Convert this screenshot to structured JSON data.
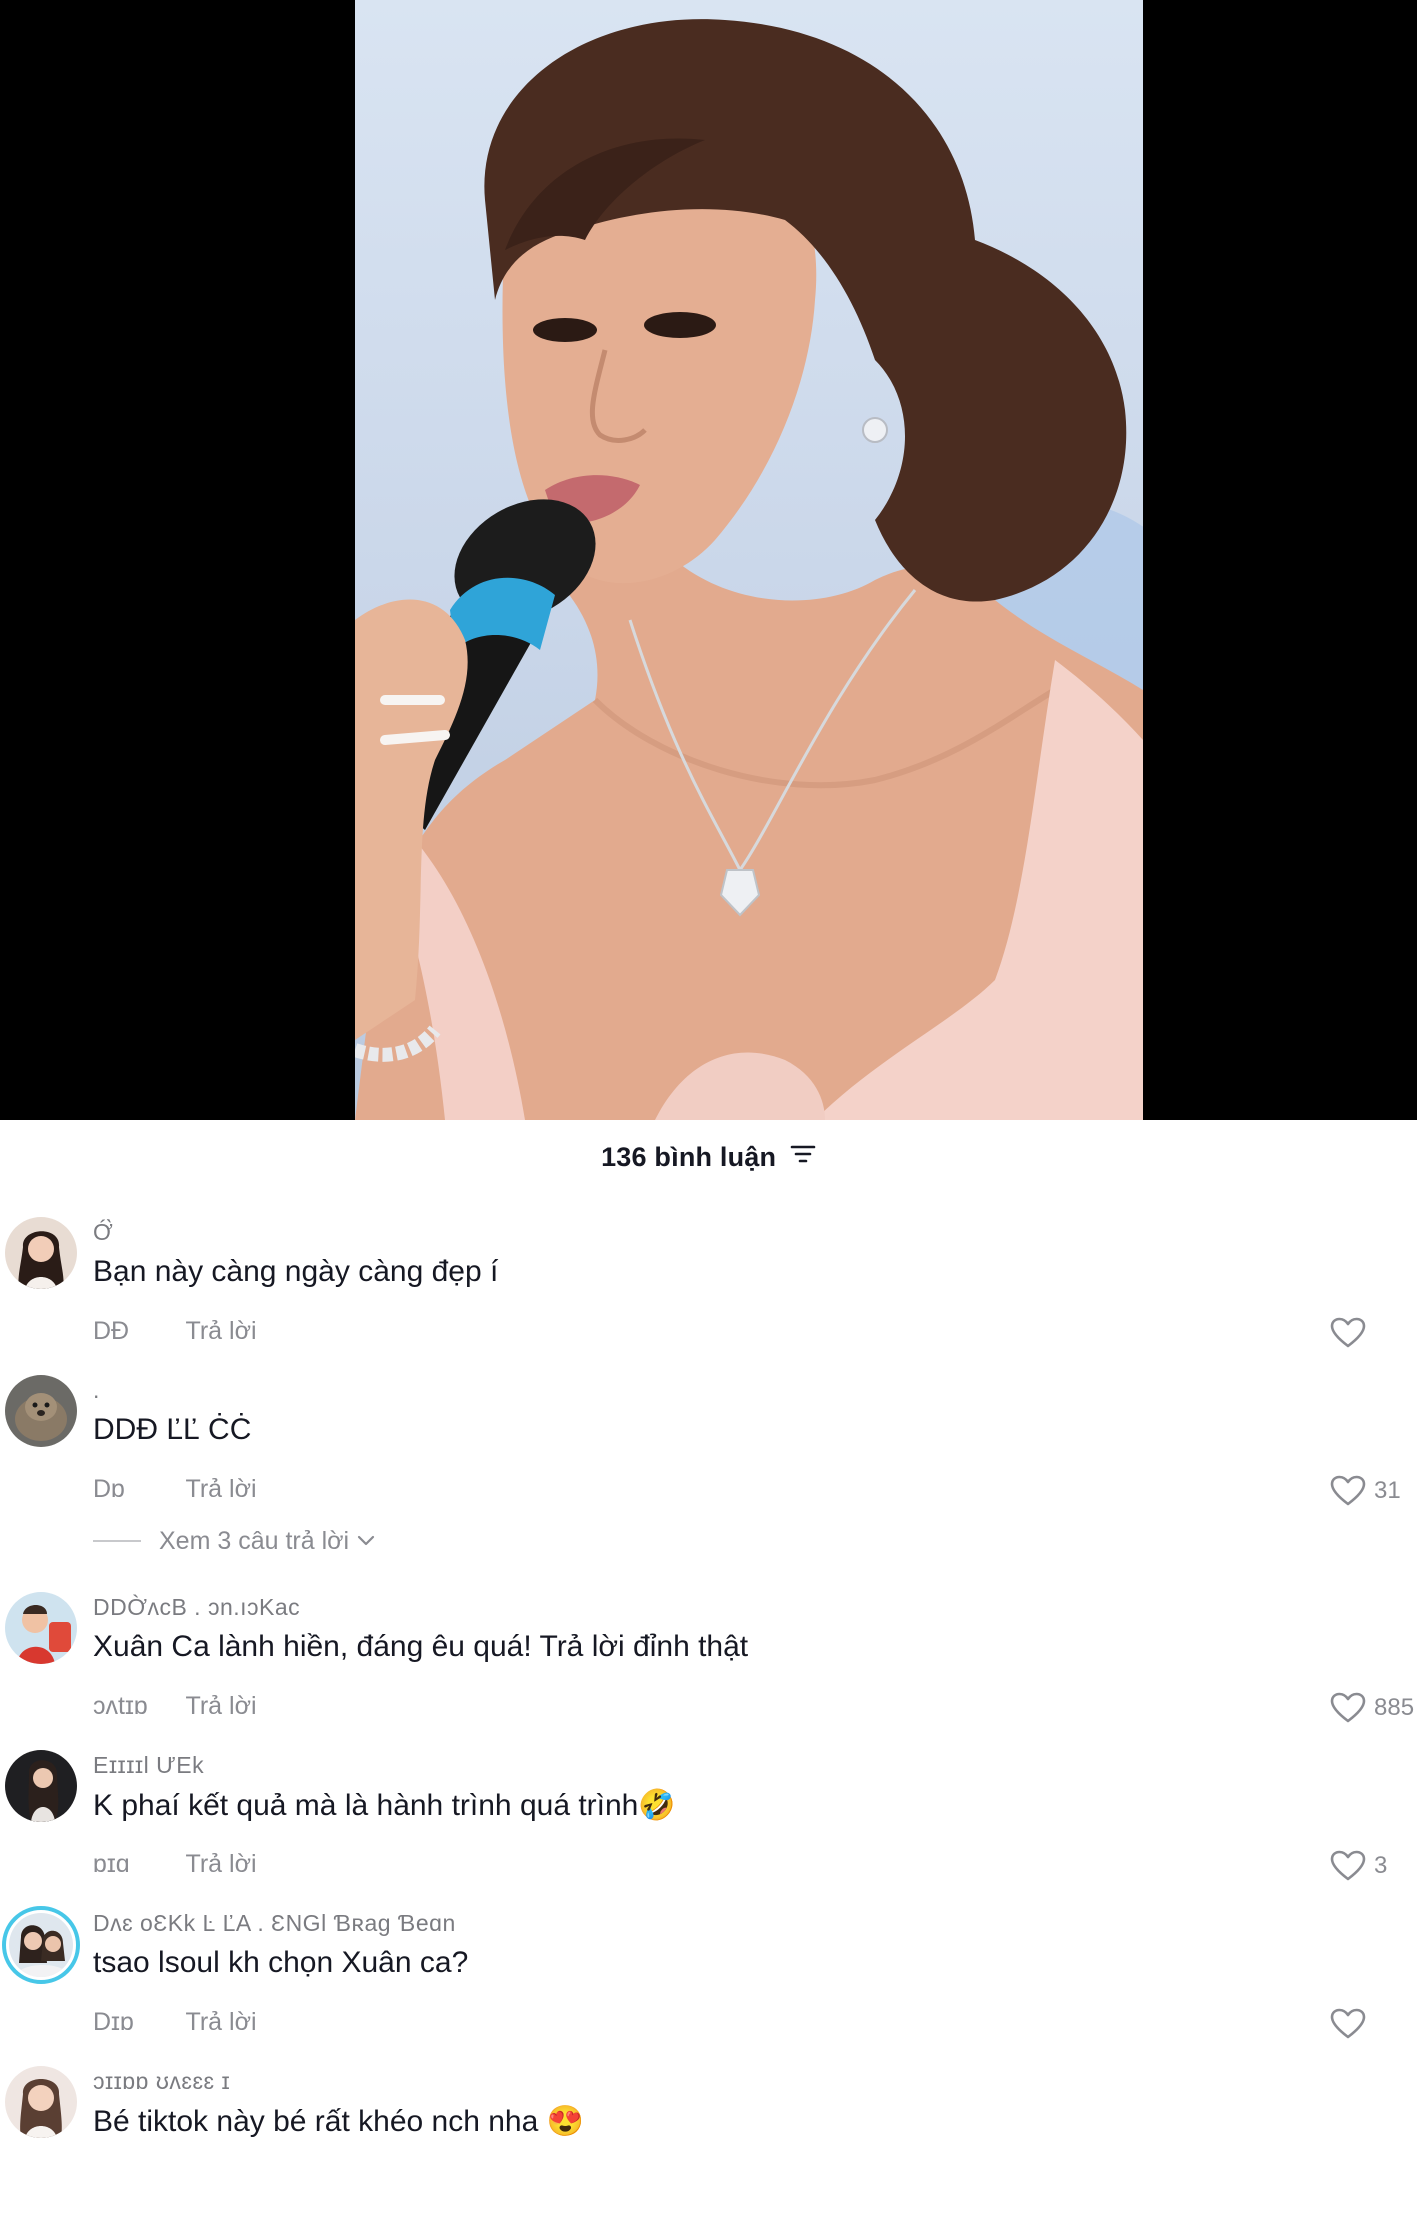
{
  "comments_header": {
    "title": "136 bình luận",
    "filter_icon": "filter-icon"
  },
  "comments": [
    {
      "username": "Ớ̀",
      "text": "Bạn này càng ngày càng đẹp í",
      "date": "DĐ",
      "reply_label": "Trả lời",
      "likes": ""
    },
    {
      "username": ".",
      "text": "DDĐ  ĽĽ  ĊĊ",
      "date": "Dɒ",
      "reply_label": "Trả lời",
      "likes": "31",
      "view_replies": "Xem 3 câu trả lời"
    },
    {
      "username": "DDỜʌcΒ . ɔn.ıɔKac",
      "text": "Xuân Ca lành hiền, đáng êu quá! Trả lời đỉnh thật",
      "date": "ɔʌtɪɒ",
      "reply_label": "Trả lời",
      "likes": "885"
    },
    {
      "username": "Eɪɪɪɪl ƯEk",
      "text": "K phaí kết quả mà là hành trình quá trình🤣",
      "date": "ɒɪɑ",
      "reply_label": "Trả lời",
      "likes": "3"
    },
    {
      "username": "Dʌɛ oƐKk Ŀ ĽA . ƐNGl Ɓʀag Ɓeɑn",
      "text": "tsao lsoul kh chọn Xuân ca?",
      "date": "Dɪɒ",
      "reply_label": "Trả lời",
      "likes": ""
    },
    {
      "username": "ɔɪɪɒɒ ʊʌɛɛɛ ɪ",
      "text": "Bé tiktok này bé rất khéo nch nha 😍",
      "date": "",
      "reply_label": "",
      "likes": ""
    }
  ],
  "icons": {
    "like": "heart-outline-icon",
    "expand": "chevron-down-icon"
  },
  "colors": {
    "text_primary": "#161823",
    "text_secondary": "#8a8b91",
    "story_ring": "#47c7e8"
  }
}
